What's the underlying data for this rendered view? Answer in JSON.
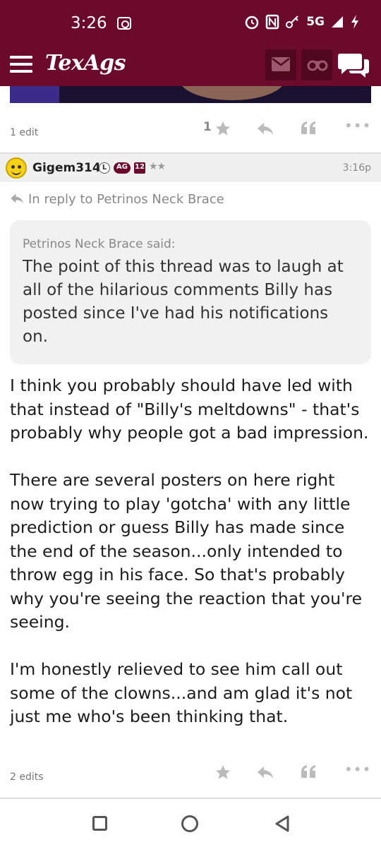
{
  "status_bar": {
    "time": "3:26",
    "network": "5G",
    "icons": [
      "camera-icon",
      "alarm-icon",
      "nfc-icon",
      "vpn-key-icon",
      "signal-icon",
      "charging-icon"
    ]
  },
  "header": {
    "logo": "TexAgs",
    "brand_color": "#6b0a2b",
    "icons": [
      "hamburger-icon",
      "mail-icon",
      "binoculars-icon",
      "chat-icon"
    ]
  },
  "previous_post": {
    "edit_note": "1 edit",
    "star_count": "1"
  },
  "post": {
    "username": "Gigem314",
    "badges": {
      "l": "L",
      "ag": "AG",
      "year": "12",
      "stars": "★★"
    },
    "time": "3:16p",
    "reply_to": "In reply to Petrinos Neck Brace",
    "quote": {
      "author": "Petrinos Neck Brace said:",
      "text": "The point of this thread was to laugh at all of the hilarious comments Billy has posted since I've had his notifications on."
    },
    "paragraphs": [
      "I think you probably should have led with that instead of \"Billy's meltdowns\" - that's probably why people got a bad impression.",
      "There are several posters on here right now trying to play 'gotcha' with any little prediction or guess Billy has made since the end of the season...only intended to throw egg in his face. So that's probably why you're seeing the reaction that you're seeing.",
      "I'm honestly relieved to see him call out some of the clowns...and am glad it's not just me who's been thinking that."
    ],
    "edit_note": "2 edits"
  }
}
